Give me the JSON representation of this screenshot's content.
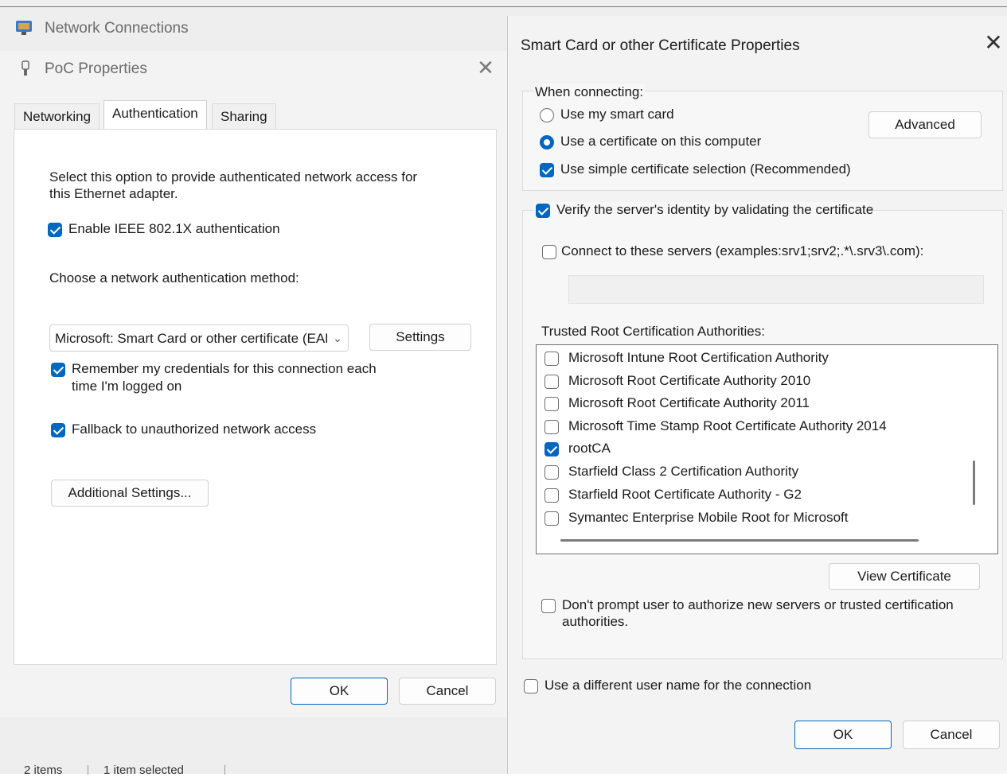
{
  "background_window": {
    "title": "Network Connections",
    "status_items": "2 items",
    "status_selected": "1 item selected"
  },
  "poc_dialog": {
    "title": "PoC Properties",
    "close_glyph": "✕",
    "tabs": [
      {
        "label": "Networking",
        "active": false
      },
      {
        "label": "Authentication",
        "active": true
      },
      {
        "label": "Sharing",
        "active": false
      }
    ],
    "intro_line1": "Select this option to provide authenticated network access for",
    "intro_line2": "this Ethernet adapter.",
    "enable_8021x": {
      "label": "Enable IEEE 802.1X authentication",
      "checked": true
    },
    "method_label": "Choose a network authentication method:",
    "method_value": "Microsoft: Smart Card or other certificate (EAP-TLS)",
    "settings_button": "Settings",
    "remember_creds": {
      "line1": "Remember my credentials for this connection each",
      "line2": "time I'm logged on",
      "checked": true
    },
    "fallback": {
      "label": "Fallback to unauthorized network access",
      "checked": true
    },
    "additional_settings_button": "Additional Settings...",
    "ok_button": "OK",
    "cancel_button": "Cancel"
  },
  "smartcard_dialog": {
    "title": "Smart Card or other Certificate Properties",
    "close_glyph": "✕",
    "when_connecting_label": "When connecting:",
    "use_smart_card": {
      "label": "Use my smart card",
      "selected": false
    },
    "use_certificate": {
      "label": "Use a certificate on this computer",
      "selected": true
    },
    "advanced_button": "Advanced",
    "simple_selection": {
      "label": "Use simple certificate selection (Recommended)",
      "checked": true
    },
    "verify_server": {
      "label": "Verify the server's identity by validating the certificate",
      "checked": true
    },
    "connect_servers": {
      "label": "Connect to these servers (examples:srv1;srv2;.*\\.srv3\\.com):",
      "checked": false
    },
    "servers_value": "",
    "trusted_root_label": "Trusted Root Certification Authorities:",
    "cas": [
      {
        "label": "Microsoft Intune Root Certification Authority",
        "checked": false
      },
      {
        "label": "Microsoft Root Certificate Authority 2010",
        "checked": false
      },
      {
        "label": "Microsoft Root Certificate Authority 2011",
        "checked": false
      },
      {
        "label": "Microsoft Time Stamp Root Certificate Authority 2014",
        "checked": false
      },
      {
        "label": "rootCA",
        "checked": true
      },
      {
        "label": "Starfield Class 2 Certification Authority",
        "checked": false
      },
      {
        "label": "Starfield Root Certificate Authority - G2",
        "checked": false
      },
      {
        "label": "Symantec Enterprise Mobile Root for Microsoft",
        "checked": false
      }
    ],
    "view_certificate_button": "View Certificate",
    "dont_prompt": {
      "line1": "Don't prompt user to authorize new servers or trusted certification",
      "line2": "authorities.",
      "checked": false
    },
    "different_user": {
      "label": "Use a different user name for the connection",
      "checked": false
    },
    "ok_button": "OK",
    "cancel_button": "Cancel"
  },
  "colors": {
    "accent": "#0067c0",
    "dialog_bg": "#f3f3f3",
    "panel_bg": "#ffffff"
  }
}
